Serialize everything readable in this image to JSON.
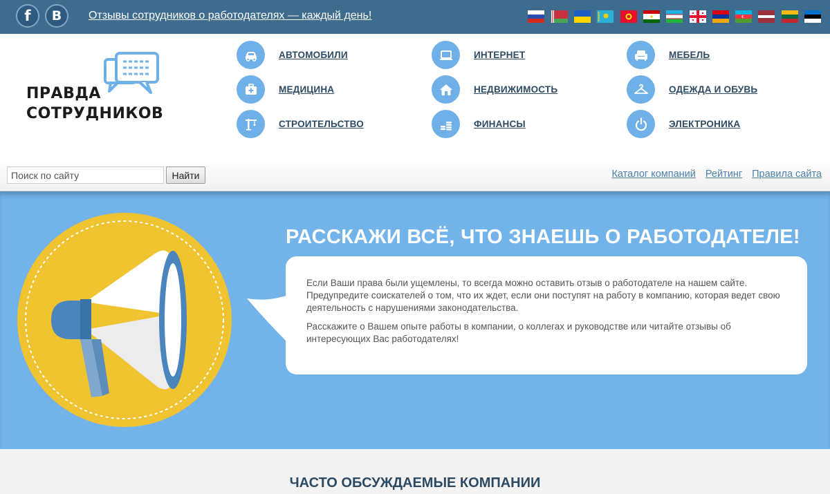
{
  "topbar": {
    "facebook_label": "f",
    "vk_label": "B",
    "tagline": "Отзывы сотрудников о работодателях — каждый день!",
    "flags": [
      "russia-flag",
      "belarus-flag",
      "ukraine-flag",
      "kazakhstan-flag",
      "kyrgyzstan-flag",
      "tajikistan-flag",
      "uzbekistan-flag",
      "georgia-flag",
      "armenia-flag",
      "azerbaijan-flag",
      "latvia-flag",
      "lithuania-flag",
      "estonia-flag"
    ]
  },
  "logo": {
    "line1": "ПРАВДА",
    "line2": "СОТРУДНИКОВ"
  },
  "categories": [
    {
      "label": "АВТОМОБИЛИ",
      "icon": "car-icon"
    },
    {
      "label": "МЕДИЦИНА",
      "icon": "medkit-icon"
    },
    {
      "label": "СТРОИТЕЛЬСТВО",
      "icon": "crane-icon"
    },
    {
      "label": "ИНТЕРНЕТ",
      "icon": "laptop-icon"
    },
    {
      "label": "НЕДВИЖИМОСТЬ",
      "icon": "house-icon"
    },
    {
      "label": "ФИНАНСЫ",
      "icon": "coins-icon"
    },
    {
      "label": "МЕБЕЛЬ",
      "icon": "armchair-icon"
    },
    {
      "label": "ОДЕЖДА И ОБУВЬ",
      "icon": "hanger-icon"
    },
    {
      "label": "ЭЛЕКТРОНИКА",
      "icon": "power-icon"
    }
  ],
  "search": {
    "placeholder": "Поиск по сайту",
    "button_label": "Найти"
  },
  "nav": {
    "catalog": "Каталог компаний",
    "rating": "Рейтинг",
    "rules": "Правила сайта"
  },
  "hero": {
    "title": "РАССКАЖИ ВСЁ, ЧТО ЗНАЕШЬ О РАБОТОДАТЕЛЕ!",
    "paragraph1": "Если Ваши права были ущемлены, то всегда можно оставить отзыв о работодателе на нашем сайте. Предупредите соискателей о том, что их ждет, если они поступят на работу в компанию, которая ведет свою деятельность с нарушениями законодательства.",
    "paragraph2": "Расскажите о Вашем опыте работы в компании, о коллегах и руководстве или читайте отзывы об интересующих Вас работодателях!"
  },
  "section": {
    "title": "ЧАСТО ОБСУЖДАЕМЫЕ КОМПАНИИ"
  },
  "colors": {
    "topbar": "#3d6c8e",
    "accent": "#72b3ea",
    "icon_bg": "#6fb0e8",
    "category_text": "#2d4a63",
    "link": "#4d7ea9"
  }
}
